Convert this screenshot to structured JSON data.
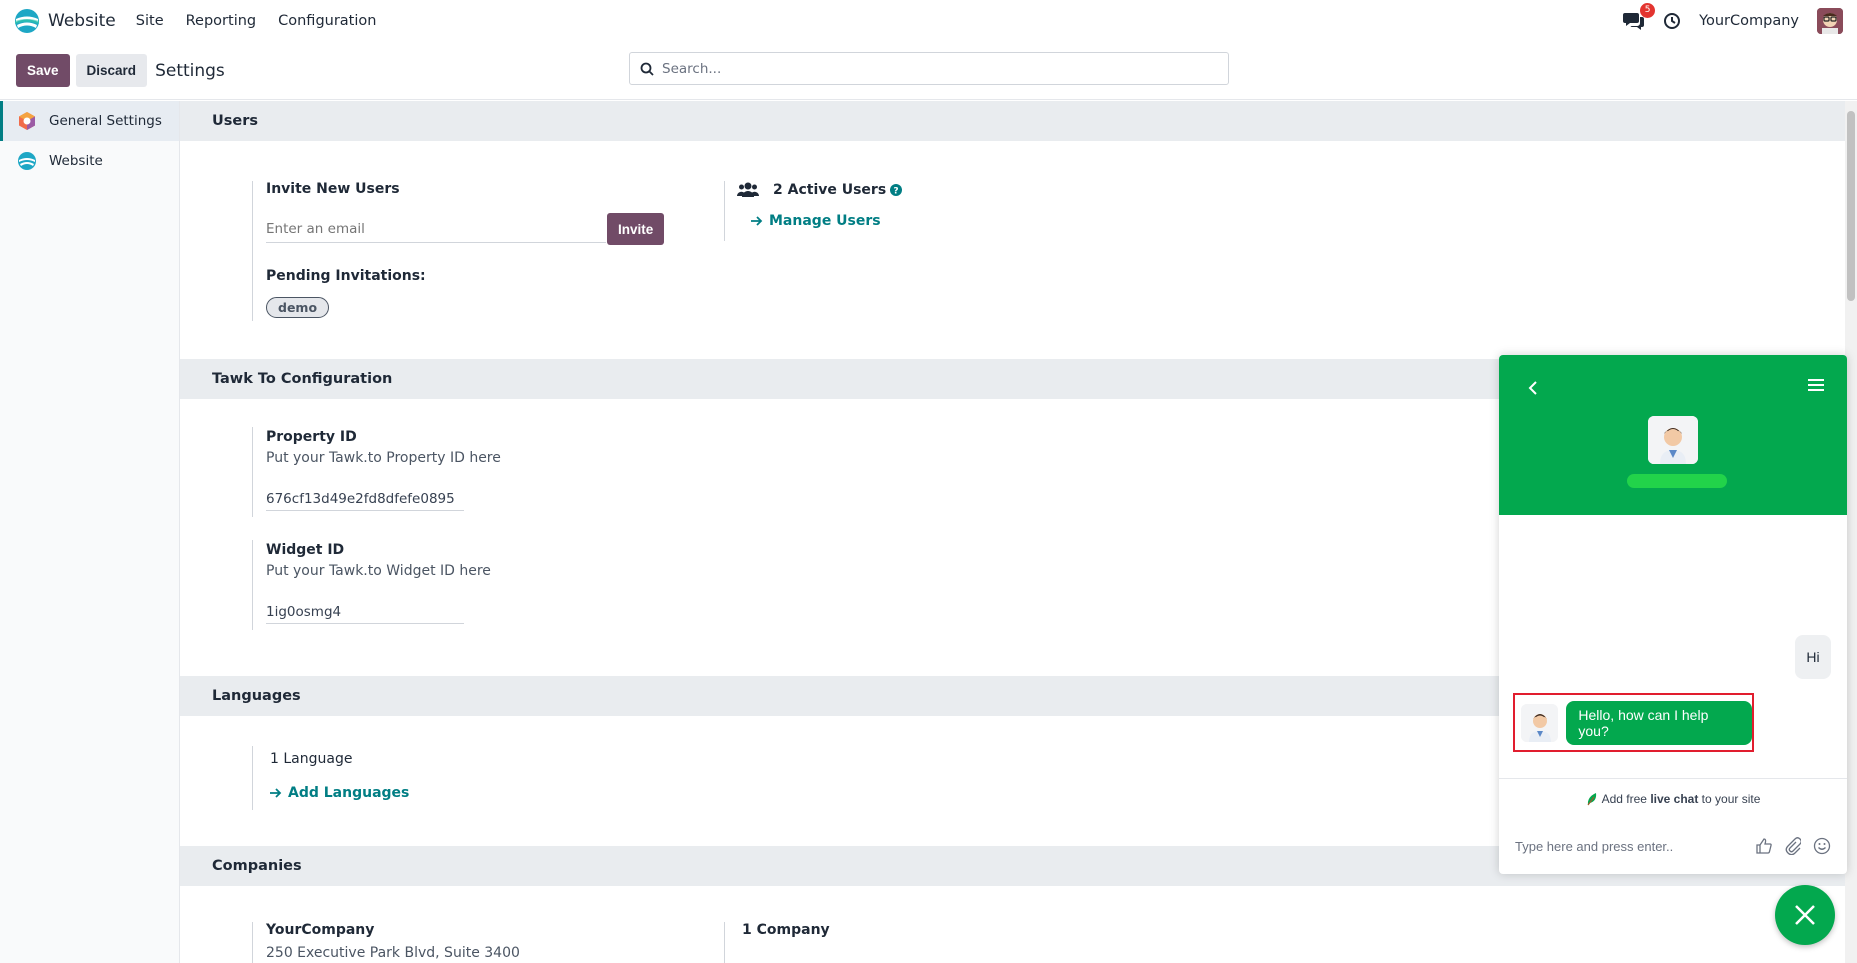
{
  "navbar": {
    "app_name": "Website",
    "menu": [
      "Site",
      "Reporting",
      "Configuration"
    ],
    "chat_count": "5",
    "company": "YourCompany"
  },
  "control": {
    "save_label": "Save",
    "discard_label": "Discard",
    "title": "Settings",
    "search_placeholder": "Search..."
  },
  "sidebar": {
    "items": [
      {
        "label": "General Settings",
        "icon": "settings-app-icon",
        "active": true
      },
      {
        "label": "Website",
        "icon": "website-app-icon",
        "active": false
      }
    ]
  },
  "users": {
    "header": "Users",
    "invite_label": "Invite New Users",
    "email_placeholder": "Enter an email",
    "invite_button": "Invite",
    "pending_label": "Pending Invitations:",
    "pending_tag": "demo",
    "active_users": "2 Active Users",
    "manage_users": "Manage Users"
  },
  "tawk_config": {
    "header": "Tawk To Configuration",
    "property_label": "Property ID",
    "property_help": "Put your Tawk.to Property ID here",
    "property_value": "676cf13d49e2fd8dfefe0895",
    "widget_label": "Widget ID",
    "widget_help": "Put your Tawk.to Widget ID here",
    "widget_value": "1ig0osmg4"
  },
  "languages": {
    "header": "Languages",
    "count": "1 Language",
    "add_link": "Add Languages"
  },
  "companies": {
    "header": "Companies",
    "company_name": "YourCompany",
    "company_address": "250 Executive Park Blvd, Suite 3400",
    "count": "1 Company"
  },
  "chat_widget": {
    "visitor_message": "Hi",
    "agent_message": "Hello, how can I help you?",
    "promo_prefix": "Add free ",
    "promo_bold": "live chat",
    "promo_suffix": " to your site",
    "input_placeholder": "Type here and press enter..",
    "accent_color": "#03a84e"
  },
  "colors": {
    "brand": "#714b67",
    "link": "#017e84"
  }
}
